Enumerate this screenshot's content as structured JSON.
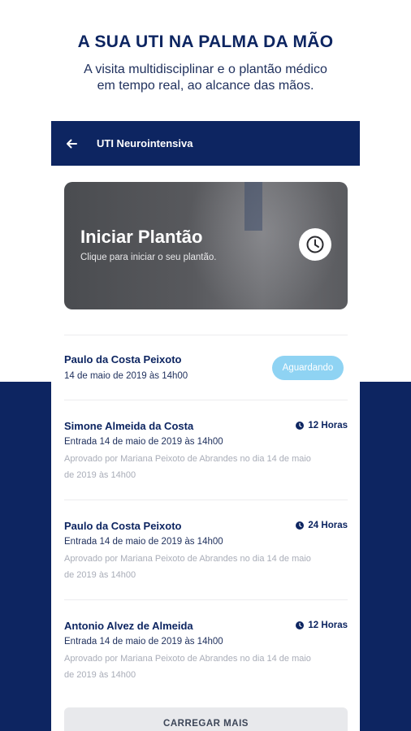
{
  "promo": {
    "headline": "A SUA UTI NA PALMA DA MÃO",
    "subline_1": "A visita multidisciplinar e o plantão médico",
    "subline_2": "em tempo real, ao alcance das mãos."
  },
  "appbar": {
    "title": "UTI Neurointensiva",
    "back_icon": "arrow-left-icon"
  },
  "hero": {
    "title": "Iniciar Plantão",
    "subtitle": "Clique para iniciar o seu plantão.",
    "icon": "clock-icon"
  },
  "pending": {
    "name": "Paulo da Costa Peixoto",
    "date": "14 de maio de 2019 às 14h00",
    "status": "Aguardando"
  },
  "shifts": [
    {
      "name": "Simone Almeida da Costa",
      "hours": "12 Horas",
      "entry": "Entrada 14 de maio de 2019 às 14h00",
      "approval_1": "Aprovado por Mariana Peixoto de Abrandes no dia 14 de maio",
      "approval_2": "de 2019 às 14h00"
    },
    {
      "name": "Paulo da Costa Peixoto",
      "hours": "24 Horas",
      "entry": "Entrada 14 de maio de 2019 às 14h00",
      "approval_1": "Aprovado por Mariana Peixoto de Abrandes no dia 14 de maio",
      "approval_2": "de 2019 às 14h00"
    },
    {
      "name": "Antonio Alvez de Almeida",
      "hours": "12 Horas",
      "entry": "Entrada 14 de maio de 2019 às 14h00",
      "approval_1": "Aprovado por Mariana Peixoto de Abrandes no dia 14 de maio",
      "approval_2": "de 2019 às 14h00"
    }
  ],
  "load_more": "CARREGAR MAIS",
  "colors": {
    "navy": "#0d2561",
    "badge": "#8fd3f3",
    "muted": "#a9adb8"
  }
}
